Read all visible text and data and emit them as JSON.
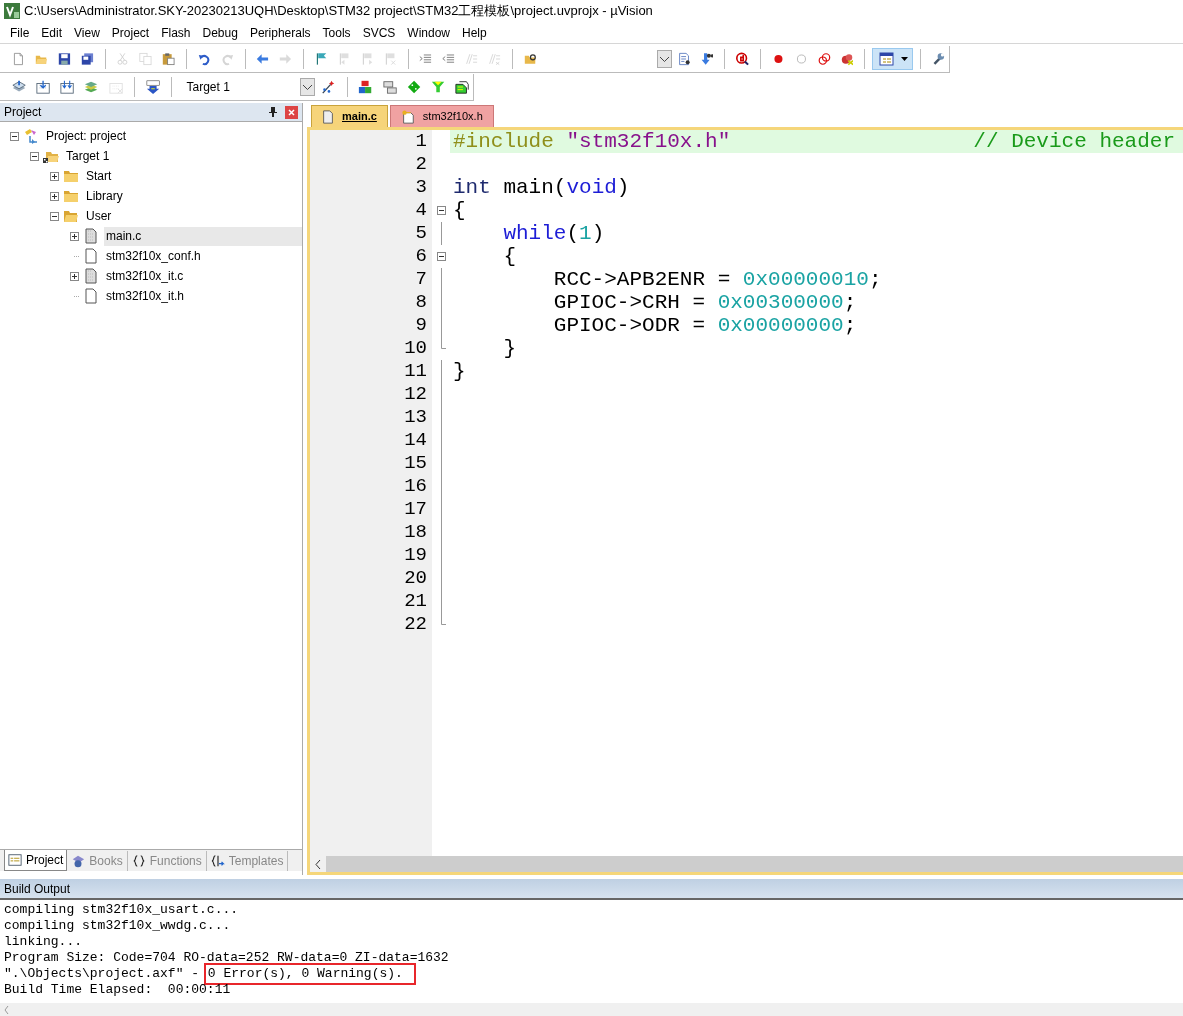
{
  "window": {
    "title": "C:\\Users\\Administrator.SKY-20230213UQH\\Desktop\\STM32 project\\STM32工程模板\\project.uvprojx - µVision"
  },
  "menu": [
    {
      "label": "File"
    },
    {
      "label": "Edit"
    },
    {
      "label": "View"
    },
    {
      "label": "Project"
    },
    {
      "label": "Flash"
    },
    {
      "label": "Debug"
    },
    {
      "label": "Peripherals"
    },
    {
      "label": "Tools"
    },
    {
      "label": "SVCS"
    },
    {
      "label": "Window"
    },
    {
      "label": "Help"
    }
  ],
  "toolbar_1": [
    {
      "kind": "new",
      "disabled": false
    },
    {
      "kind": "open",
      "disabled": false
    },
    {
      "kind": "save",
      "disabled": false
    },
    {
      "kind": "saveall",
      "disabled": false
    },
    {
      "kind": "sep"
    },
    {
      "kind": "cut",
      "disabled": true
    },
    {
      "kind": "copy",
      "disabled": true
    },
    {
      "kind": "paste",
      "disabled": false
    },
    {
      "kind": "sep"
    },
    {
      "kind": "undo",
      "disabled": false
    },
    {
      "kind": "redo",
      "disabled": true
    },
    {
      "kind": "sep"
    },
    {
      "kind": "back",
      "disabled": false
    },
    {
      "kind": "forward",
      "disabled": true
    },
    {
      "kind": "sep"
    },
    {
      "kind": "flag",
      "disabled": false
    },
    {
      "kind": "flagprev",
      "disabled": true
    },
    {
      "kind": "flagnext",
      "disabled": true
    },
    {
      "kind": "flagclear",
      "disabled": true
    },
    {
      "kind": "sep"
    },
    {
      "kind": "indent",
      "disabled": false
    },
    {
      "kind": "unindent",
      "disabled": false
    },
    {
      "kind": "comment",
      "disabled": true
    },
    {
      "kind": "uncomment",
      "disabled": true
    },
    {
      "kind": "sep"
    },
    {
      "kind": "findfiles",
      "disabled": false
    },
    {
      "kind": "combo"
    },
    {
      "kind": "find",
      "disabled": false
    },
    {
      "kind": "incfind",
      "disabled": false
    },
    {
      "kind": "sep"
    },
    {
      "kind": "debug",
      "disabled": false
    },
    {
      "kind": "sep"
    },
    {
      "kind": "breakpoint",
      "disabled": false
    },
    {
      "kind": "bpdisable",
      "disabled": false
    },
    {
      "kind": "bpdisableall",
      "disabled": false
    },
    {
      "kind": "bpkill",
      "disabled": false
    },
    {
      "kind": "sep"
    },
    {
      "kind": "windows",
      "disabled": false
    },
    {
      "kind": "sep"
    },
    {
      "kind": "settings",
      "disabled": false
    }
  ],
  "toolbar_2": [
    {
      "kind": "translate",
      "disabled": false
    },
    {
      "kind": "build",
      "disabled": false
    },
    {
      "kind": "rebuild",
      "disabled": false
    },
    {
      "kind": "batch",
      "disabled": false
    },
    {
      "kind": "stop",
      "disabled": true
    },
    {
      "kind": "sep"
    },
    {
      "kind": "load",
      "disabled": false
    },
    {
      "kind": "sep"
    },
    {
      "kind": "target",
      "text": "Target 1"
    },
    {
      "kind": "wand",
      "disabled": false
    },
    {
      "kind": "sep"
    },
    {
      "kind": "manage",
      "disabled": false
    },
    {
      "kind": "layers",
      "disabled": false
    },
    {
      "kind": "diamond",
      "disabled": false
    },
    {
      "kind": "funnel",
      "disabled": false
    },
    {
      "kind": "packs",
      "disabled": false
    }
  ],
  "project_panel": {
    "title": "Project",
    "tree": [
      {
        "label": "Project: project",
        "kind": "project",
        "expandable": true,
        "expanded": true,
        "selected": false,
        "children": [
          {
            "label": "Target 1",
            "kind": "target",
            "expandable": true,
            "expanded": true,
            "selected": false,
            "children": [
              {
                "label": "Start",
                "kind": "folder",
                "expandable": true,
                "expanded": false,
                "selected": false
              },
              {
                "label": "Library",
                "kind": "folder",
                "expandable": true,
                "expanded": false,
                "selected": false
              },
              {
                "label": "User",
                "kind": "folder",
                "expandable": true,
                "expanded": true,
                "selected": false,
                "children": [
                  {
                    "label": "main.c",
                    "kind": "source",
                    "expandable": true,
                    "expanded": false,
                    "selected": true
                  },
                  {
                    "label": "stm32f10x_conf.h",
                    "kind": "header",
                    "expandable": false,
                    "expanded": false,
                    "selected": false
                  },
                  {
                    "label": "stm32f10x_it.c",
                    "kind": "source",
                    "expandable": true,
                    "expanded": false,
                    "selected": false
                  },
                  {
                    "label": "stm32f10x_it.h",
                    "kind": "header",
                    "expandable": false,
                    "expanded": false,
                    "selected": false
                  }
                ]
              }
            ]
          }
        ]
      }
    ],
    "tabs": [
      {
        "label": "Project",
        "kind": "project",
        "selected": true
      },
      {
        "label": "Books",
        "kind": "books",
        "selected": false
      },
      {
        "label": "Functions",
        "kind": "functions",
        "selected": false
      },
      {
        "label": "Templates",
        "kind": "templates",
        "selected": false
      }
    ]
  },
  "editor": {
    "tabs": [
      {
        "label": "main.c",
        "read_only": false,
        "selected": true
      },
      {
        "label": "stm32f10x.h",
        "read_only": true,
        "selected": false
      }
    ],
    "lines": [
      {
        "number": "1",
        "current": true,
        "segments": [
          {
            "kind": "preproc",
            "text": "#include"
          },
          {
            "kind": "string",
            "text": " \"stm32f10x.h\""
          },
          {
            "kind": "comment",
            "text": "// Device header"
          }
        ]
      },
      {
        "number": "2",
        "current": false
      },
      {
        "number": "3",
        "current": false,
        "segments": [
          {
            "kind": "type",
            "text": "int"
          },
          {
            "kind": "plain",
            "text": " main("
          },
          {
            "kind": "keyword",
            "text": "void"
          },
          {
            "kind": "plain",
            "text": ")"
          }
        ]
      },
      {
        "number": "4",
        "current": false,
        "fold": {
          "kind": "start"
        },
        "segments": [
          {
            "kind": "plain",
            "text": "{"
          }
        ]
      },
      {
        "number": "5",
        "current": false,
        "fold": {
          "kind": "line"
        },
        "segments": [
          {
            "kind": "keyword",
            "text": "    while"
          },
          {
            "kind": "plain",
            "text": "("
          },
          {
            "kind": "number",
            "text": "1"
          },
          {
            "kind": "plain",
            "text": ")"
          }
        ]
      },
      {
        "number": "6",
        "current": false,
        "fold": {
          "kind": "start"
        },
        "segments": [
          {
            "kind": "plain",
            "text": "    {"
          }
        ]
      },
      {
        "number": "7",
        "current": false,
        "fold": {
          "kind": "line"
        },
        "segments": [
          {
            "kind": "plain",
            "text": "        RCC->APB2ENR = "
          },
          {
            "kind": "number",
            "text": "0x00000010"
          },
          {
            "kind": "plain",
            "text": ";"
          }
        ]
      },
      {
        "number": "8",
        "current": false,
        "fold": {
          "kind": "line"
        },
        "segments": [
          {
            "kind": "plain",
            "text": "        GPIOC->CRH = "
          },
          {
            "kind": "number",
            "text": "0x00300000"
          },
          {
            "kind": "plain",
            "text": ";"
          }
        ]
      },
      {
        "number": "9",
        "current": false,
        "fold": {
          "kind": "line"
        },
        "segments": [
          {
            "kind": "plain",
            "text": "        GPIOC->ODR = "
          },
          {
            "kind": "number",
            "text": "0x00000000"
          },
          {
            "kind": "plain",
            "text": ";"
          }
        ]
      },
      {
        "number": "10",
        "current": false,
        "fold": {
          "kind": "end"
        },
        "segments": [
          {
            "kind": "plain",
            "text": "    }"
          }
        ]
      },
      {
        "number": "11",
        "current": false,
        "fold": {
          "kind": "line"
        },
        "segments": [
          {
            "kind": "plain",
            "text": "}"
          }
        ]
      },
      {
        "number": "12",
        "current": false,
        "fold": {
          "kind": "line"
        }
      },
      {
        "number": "13",
        "current": false,
        "fold": {
          "kind": "line"
        }
      },
      {
        "number": "14",
        "current": false,
        "fold": {
          "kind": "line"
        }
      },
      {
        "number": "15",
        "current": false,
        "fold": {
          "kind": "line"
        }
      },
      {
        "number": "16",
        "current": false,
        "fold": {
          "kind": "line"
        }
      },
      {
        "number": "17",
        "current": false,
        "fold": {
          "kind": "line"
        }
      },
      {
        "number": "18",
        "current": false,
        "fold": {
          "kind": "line"
        }
      },
      {
        "number": "19",
        "current": false,
        "fold": {
          "kind": "line"
        }
      },
      {
        "number": "20",
        "current": false,
        "fold": {
          "kind": "line"
        }
      },
      {
        "number": "21",
        "current": false,
        "fold": {
          "kind": "line"
        }
      },
      {
        "number": "22",
        "current": false,
        "fold": {
          "kind": "end"
        }
      }
    ]
  },
  "build_output": {
    "title": "Build Output",
    "lines": [
      [
        {
          "text": "compiling stm32f10x_usart.c...",
          "highlighted": false
        }
      ],
      [
        {
          "text": "compiling stm32f10x_wwdg.c...",
          "highlighted": false
        }
      ],
      [
        {
          "text": "linking...",
          "highlighted": false
        }
      ],
      [
        {
          "text": "Program Size: Code=704 RO-data=252 RW-data=0 ZI-data=1632",
          "highlighted": false
        }
      ],
      [
        {
          "text": "\".\\Objects\\project.axf\" - ",
          "highlighted": false
        },
        {
          "text": "0 Error(s), 0 Warning(s).",
          "highlighted": true
        }
      ],
      [
        {
          "text": "Build Time Elapsed:  00:00:11",
          "highlighted": false
        }
      ]
    ]
  }
}
